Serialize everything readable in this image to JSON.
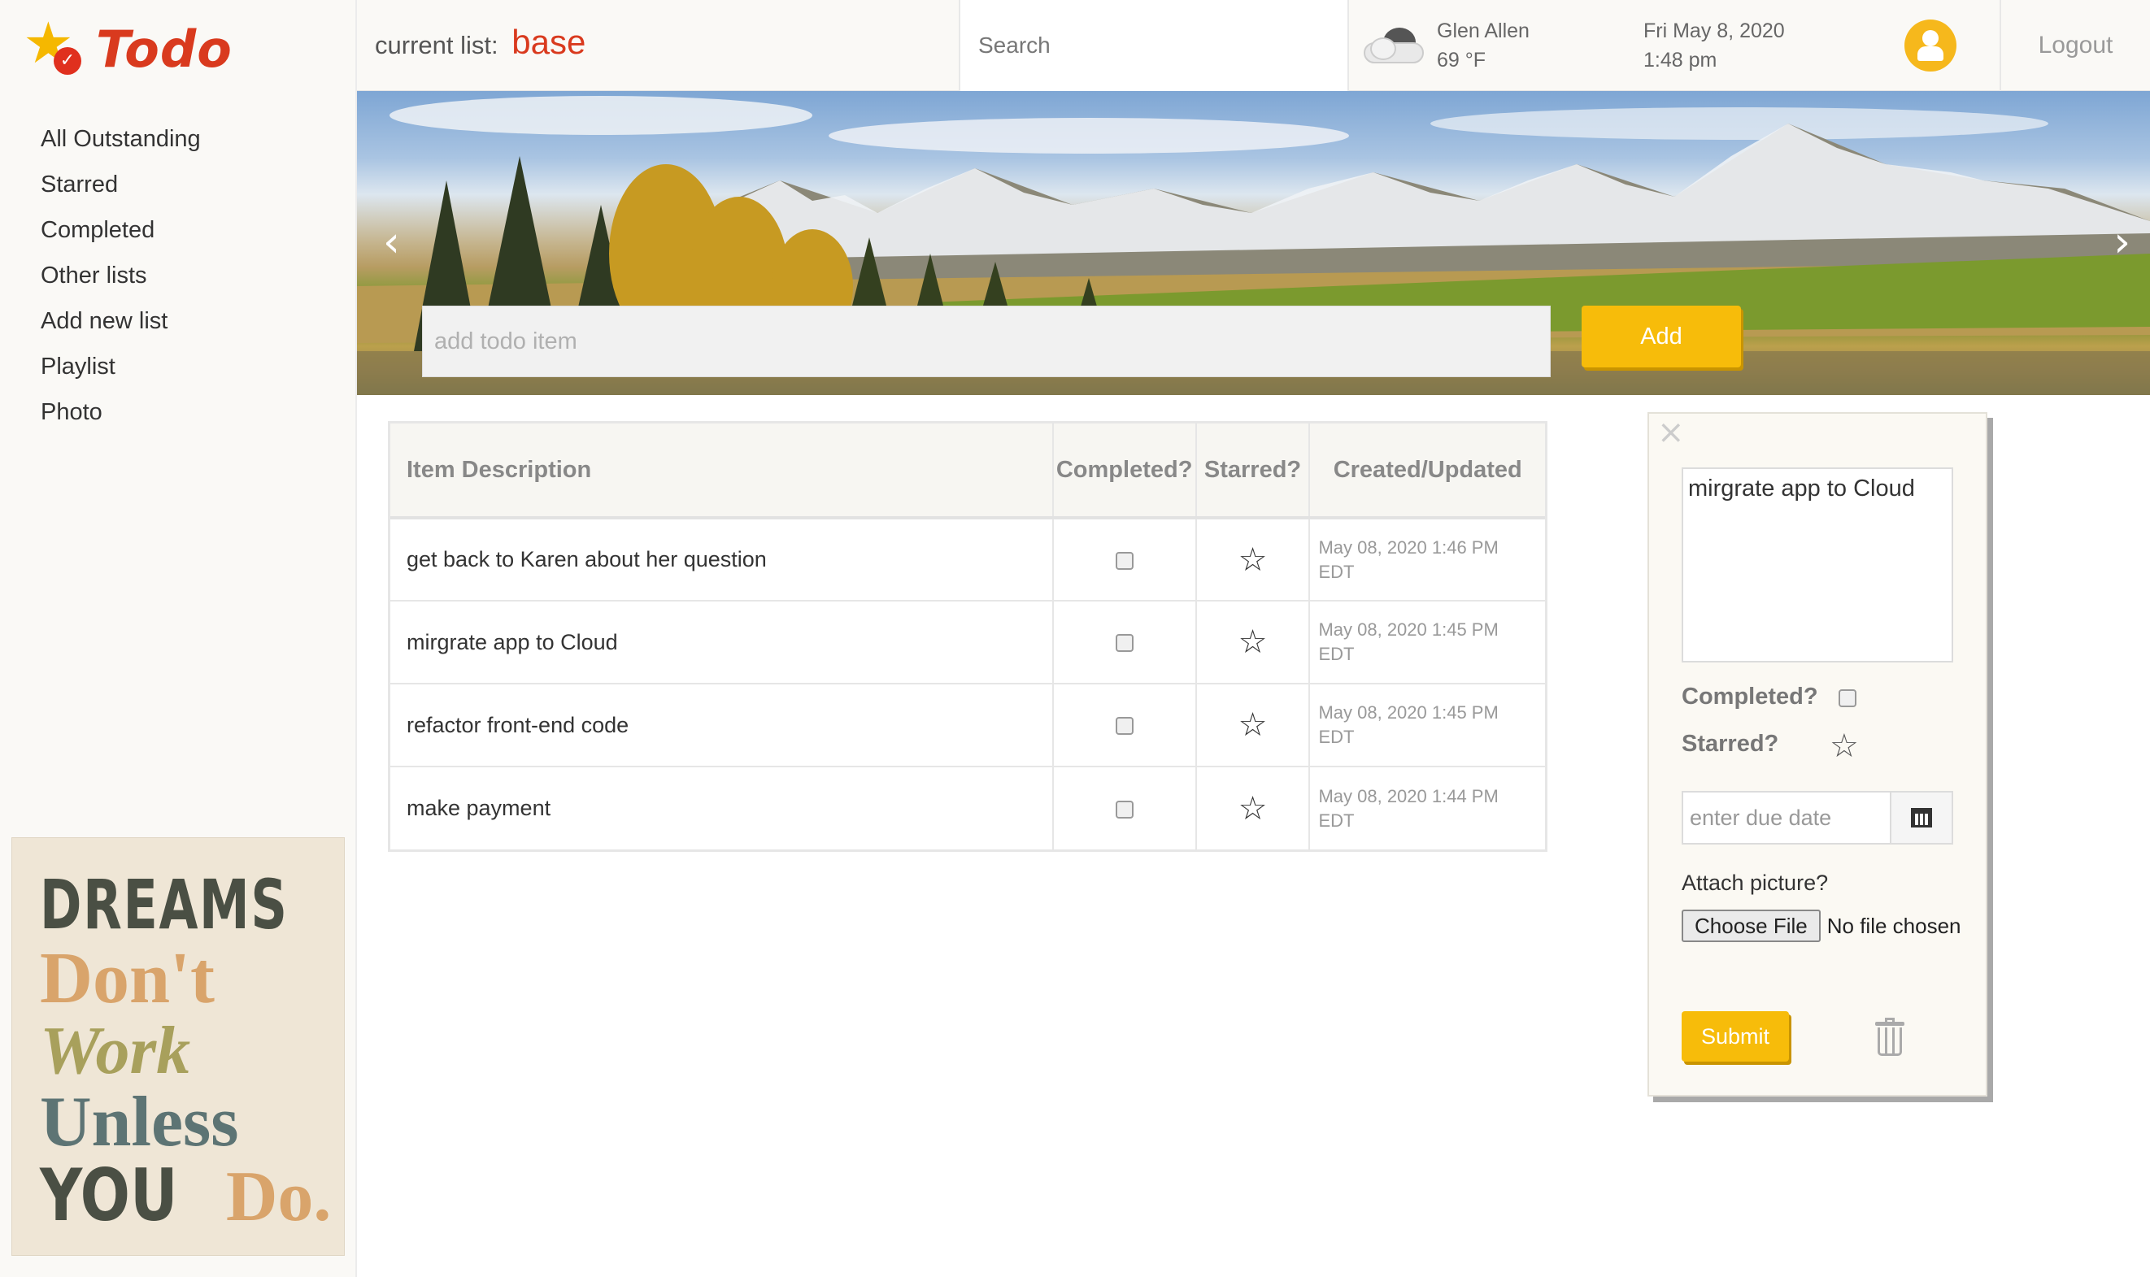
{
  "app": {
    "name": "Todo",
    "logo_icon": "star-check-icon"
  },
  "sidebar": {
    "items": [
      {
        "label": "All Outstanding"
      },
      {
        "label": "Starred"
      },
      {
        "label": "Completed"
      },
      {
        "label": "Other lists"
      },
      {
        "label": "Add new list"
      },
      {
        "label": "Playlist"
      },
      {
        "label": "Photo"
      }
    ],
    "poster": {
      "line1": "DREAMS",
      "line2": "Don't",
      "line3": "Work",
      "line4": "Unless",
      "line5a": "YOU",
      "line5b": "Do."
    }
  },
  "header": {
    "current_list_label": "current list:",
    "current_list_name": "base",
    "search_placeholder": "Search",
    "weather": {
      "location": "Glen Allen",
      "temp": "69 °F",
      "icon": "cloudy-icon"
    },
    "date": "Fri May 8, 2020",
    "time": "1:48 pm",
    "avatar_icon": "user-icon",
    "logout_label": "Logout"
  },
  "banner": {
    "prev_label": "‹",
    "next_label": "›",
    "add_placeholder": "add todo item",
    "add_label": "Add"
  },
  "table": {
    "headers": [
      "Item Description",
      "Completed?",
      "Starred?",
      "Created/Updated"
    ],
    "rows": [
      {
        "description": "get back to Karen about her question",
        "completed": false,
        "starred": false,
        "date": "May 08, 2020 1:46 PM",
        "tz": "EDT"
      },
      {
        "description": "mirgrate app to Cloud",
        "completed": false,
        "starred": false,
        "date": "May 08, 2020 1:45 PM",
        "tz": "EDT"
      },
      {
        "description": "refactor front-end code",
        "completed": false,
        "starred": false,
        "date": "May 08, 2020 1:45 PM",
        "tz": "EDT"
      },
      {
        "description": "make payment",
        "completed": false,
        "starred": false,
        "date": "May 08, 2020 1:44 PM",
        "tz": "EDT"
      }
    ]
  },
  "detail": {
    "close_label": "×",
    "text": "mirgrate app to Cloud",
    "completed_label": "Completed?",
    "starred_label": "Starred?",
    "due_placeholder": "enter due date",
    "attach_label": "Attach picture?",
    "choose_file_label": "Choose File",
    "file_status": "No file chosen",
    "submit_label": "Submit"
  },
  "colors": {
    "accent": "#f7bc0a",
    "brand_red": "#d93a1e",
    "sidebar_bg": "#faf9f6"
  }
}
